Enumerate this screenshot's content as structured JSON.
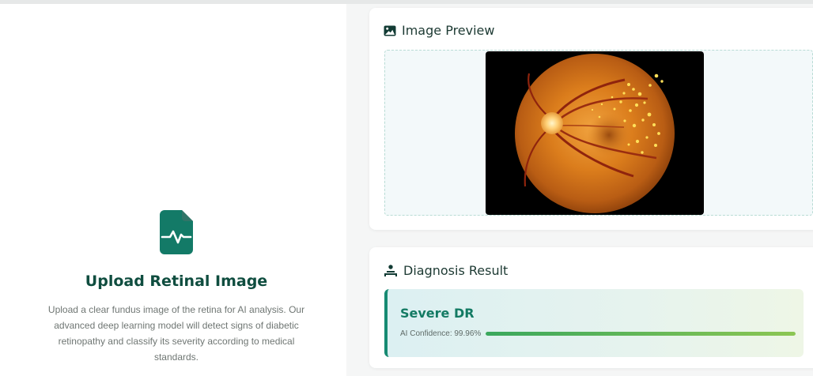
{
  "upload": {
    "icon": "file-waveform-icon",
    "title": "Upload Retinal Image",
    "description": "Upload a clear fundus image of the retina for AI analysis. Our advanced deep learning model will detect signs of diabetic retinopathy and classify its severity according to medical standards."
  },
  "preview": {
    "icon": "image-icon",
    "title": "Image Preview",
    "image_subject": "retinal fundus photograph"
  },
  "result": {
    "icon": "user-injured-icon",
    "title": "Diagnosis Result",
    "diagnosis": "Severe DR",
    "confidence_label": "AI Confidence: 99.96%",
    "confidence_value": 99.96
  },
  "colors": {
    "accent": "#168a72",
    "title_dark": "#0f4d3f",
    "confidence_bar": "#5bb556"
  }
}
